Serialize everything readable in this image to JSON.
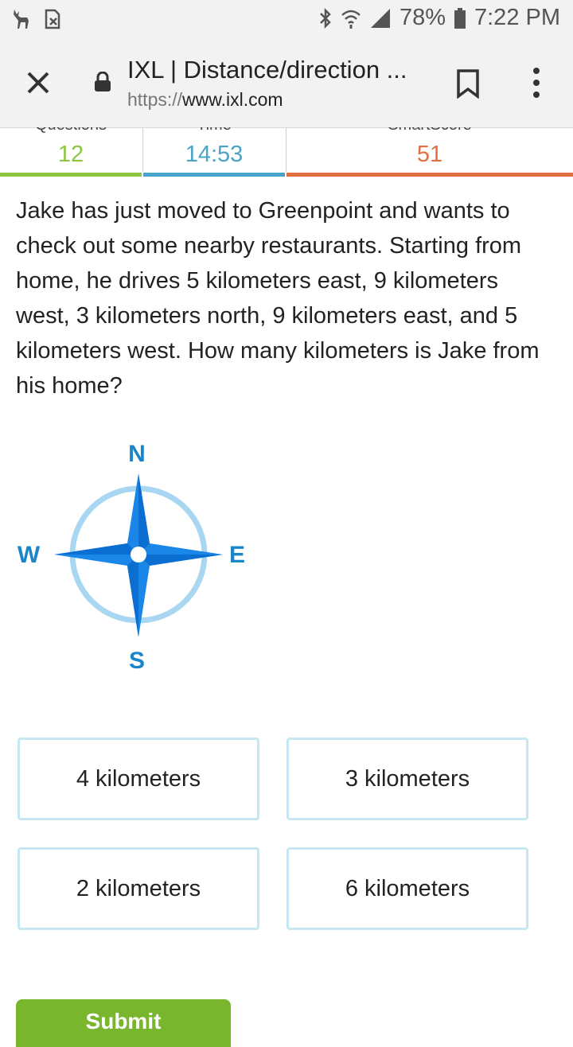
{
  "status_bar": {
    "battery": "78%",
    "time": "7:22 PM",
    "icons": [
      "deer-icon",
      "sim-card-x-icon",
      "bluetooth-icon",
      "wifi-icon",
      "signal-icon",
      "battery-icon"
    ]
  },
  "browser": {
    "title": "IXL | Distance/direction ...",
    "url_protocol": "https://",
    "url_host": "www.ixl.com"
  },
  "stats": {
    "questions_label": "Questions",
    "questions_value": "12",
    "time_label": "Time",
    "time_value": "14:53",
    "smartscore_label": "SmartScore",
    "smartscore_value": "51",
    "colors": {
      "questions": "#8dc63f",
      "time": "#4aa3c8",
      "smartscore": "#e0703f"
    }
  },
  "question": {
    "text": "Jake has just moved to Greenpoint and wants to check out some nearby restaurants. Starting from home, he drives 5 kilometers east, 9 kilometers west, 3 kilometers north, 9 kilometers east, and 5 kilometers west. How many kilometers is Jake from his home?"
  },
  "compass": {
    "n": "N",
    "s": "S",
    "e": "E",
    "w": "W"
  },
  "answers": [
    "4 kilometers",
    "3 kilometers",
    "2 kilometers",
    "6 kilometers"
  ],
  "submit_label": "Submit"
}
